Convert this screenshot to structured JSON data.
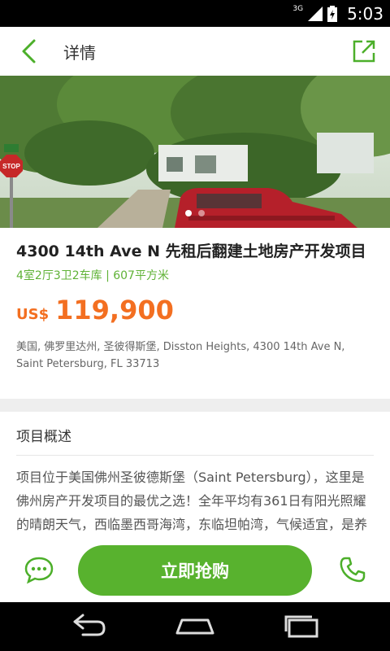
{
  "status_bar": {
    "network": "3G",
    "time": "5:03"
  },
  "app_bar": {
    "title": "详情"
  },
  "photo": {
    "sign_text": "STOP",
    "slide_count": 2,
    "active_slide": 1
  },
  "listing": {
    "title": "4300 14th Ave N 先租后翻建土地房产开发项目",
    "specs": "4室2厅3卫2车库 | 607平方米",
    "price_currency": "US$",
    "price_value": "119,900",
    "address": "美国, 佛罗里达州, 圣彼得斯堡, Disston Heights, 4300 14th Ave N, Saint Petersburg, FL 33713"
  },
  "overview": {
    "heading": "项目概述",
    "text": "项目位于美国佛州圣彼德斯堡（Saint Petersburg），这里是佛州房产开发项目的最优之选！全年平均有361日有阳光照耀的晴朗天气，西临墨西哥海湾，东临坦帕湾，气候适宜，是养老、旅游、度假的最佳城市。"
  },
  "actions": {
    "buy_label": "立即抢购"
  },
  "colors": {
    "accent": "#58b22e",
    "price": "#f36f21",
    "spec": "#5fb236"
  },
  "icons": [
    "back-arrow-icon",
    "share-icon",
    "chat-icon",
    "phone-icon",
    "nav-back-icon",
    "nav-home-icon",
    "nav-recents-icon"
  ]
}
